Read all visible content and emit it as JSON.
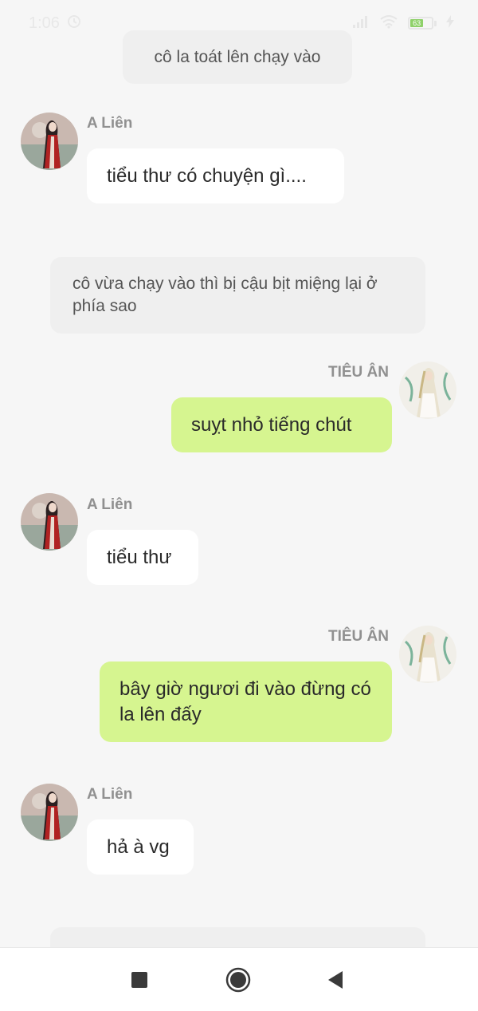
{
  "status_bar": {
    "time": "1:06",
    "battery_level": "63",
    "icons": [
      "alarm-icon",
      "signal-icon",
      "wifi-icon",
      "battery-icon",
      "charging-icon"
    ]
  },
  "messages": [
    {
      "type": "narration",
      "text": "cô la toát lên chạy vào"
    },
    {
      "type": "left",
      "sender": "A Liên",
      "text": "tiểu thư có chuyện gì...."
    },
    {
      "type": "narration",
      "text": "cô vừa chạy vào thì bị cậu bịt miệng lại ở phía sao"
    },
    {
      "type": "right",
      "sender": "TIÊU ÂN",
      "text": "suỵt nhỏ tiếng chút"
    },
    {
      "type": "left",
      "sender": "A Liên",
      "text": "tiểu thư"
    },
    {
      "type": "right",
      "sender": "TIÊU ÂN",
      "text": "bây giờ ngươi đi vào đừng có la lên đấy"
    },
    {
      "type": "left",
      "sender": "A Liên",
      "text": "hả à vg"
    }
  ],
  "nav_bar": {
    "icons": [
      "recents-square-icon",
      "home-circle-icon",
      "back-triangle-icon"
    ]
  },
  "colors": {
    "background": "#f6f6f6",
    "left_bubble": "#ffffff",
    "right_bubble": "#d6f590",
    "narration_bubble": "#efefef"
  }
}
